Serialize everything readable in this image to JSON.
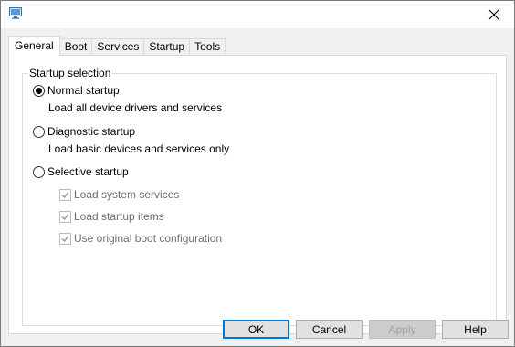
{
  "tabs": [
    {
      "label": "General",
      "active": true
    },
    {
      "label": "Boot"
    },
    {
      "label": "Services"
    },
    {
      "label": "Startup"
    },
    {
      "label": "Tools"
    }
  ],
  "startup_selection": {
    "legend": "Startup selection",
    "normal": {
      "label": "Normal startup",
      "description": "Load all device drivers and services",
      "selected": true
    },
    "diagnostic": {
      "label": "Diagnostic startup",
      "description": "Load basic devices and services only",
      "selected": false
    },
    "selective": {
      "label": "Selective startup",
      "selected": false,
      "options": [
        {
          "label": "Load system services",
          "checked": true,
          "enabled": false
        },
        {
          "label": "Load startup items",
          "checked": true,
          "enabled": false
        },
        {
          "label": "Use original boot configuration",
          "checked": true,
          "enabled": false
        }
      ]
    }
  },
  "buttons": {
    "ok": "OK",
    "cancel": "Cancel",
    "apply": "Apply",
    "help": "Help"
  },
  "icons": {
    "app": "msconfig-icon",
    "close": "close-icon"
  },
  "colors": {
    "accent": "#0078d7",
    "panel": "#f0f0f0"
  }
}
